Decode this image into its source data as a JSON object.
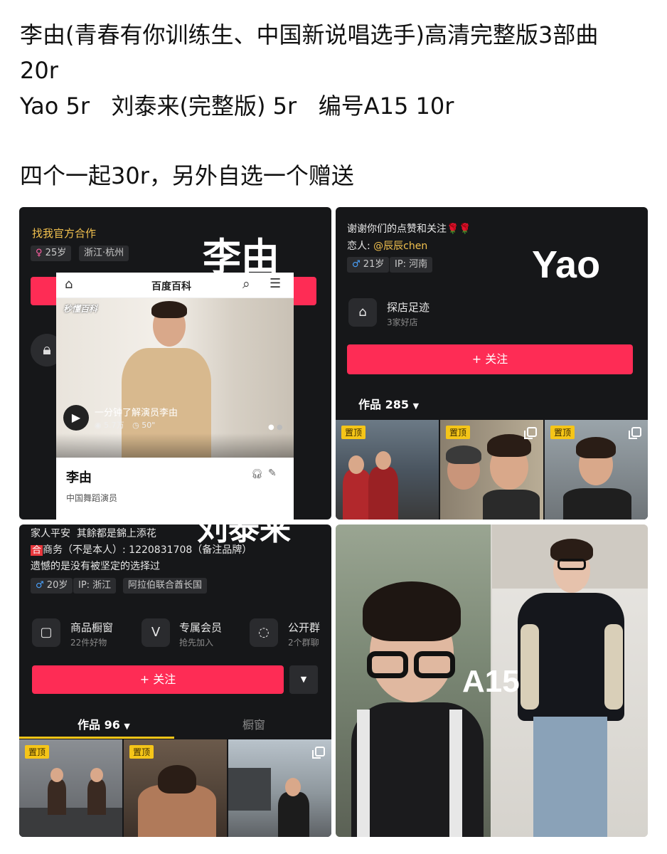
{
  "post": {
    "line1": "李由(青春有你训练生、中国新说唱选手)高清完整版3部曲",
    "line2": "20r",
    "line3": "Yao 5r   刘泰来(完整版) 5r   编号A15 10r",
    "line4": "四个一起30r，另外自选一个赠送"
  },
  "panel1": {
    "cooperate": "找我官方合作",
    "age_tag": "25岁",
    "location_tag": "浙江·杭州",
    "overlay_name": "李由",
    "baike_title": "百度百科",
    "baike_watermark": "秒懂百科",
    "video_title": "一分钟了解演员李由",
    "video_views": "5.7万",
    "video_duration": "50\"",
    "person_name": "李由",
    "person_desc": "中国舞蹈演员"
  },
  "panel2": {
    "bio_line1": "谢谢你们的点赞和关注🌹🌹",
    "bio_lover_prefix": "恋人: ",
    "bio_lover_name": "@辰辰chen",
    "age_tag": "21岁",
    "ip_tag": "IP: 河南",
    "overlay_name": "Yao",
    "shop_title": "探店足迹",
    "shop_sub": "3家好店",
    "follow_label": "+ 关注",
    "works_label": "作品 285",
    "pinned_label": "置顶"
  },
  "panel3": {
    "overlay_name": "刘泰来",
    "bio_line1": "家人平安  其餘都是錦上添花",
    "bio_line2_badge": "合",
    "bio_line2": "商务（不是本人）: 1220831708（备注品牌）",
    "bio_line3": "遗憾的是没有被坚定的选择过",
    "age_tag": "20岁",
    "ip_tag": "IP: 浙江",
    "region_tag": "阿拉伯联合酋长国",
    "svc1_title": "商品橱窗",
    "svc1_sub": "22件好物",
    "svc2_title": "专属会员",
    "svc2_sub": "抢先加入",
    "svc3_title": "公开群",
    "svc3_sub": "2个群聊",
    "follow_label": "+ 关注",
    "tab_works": "作品 96",
    "tab_shop": "橱窗",
    "pinned_label": "置顶"
  },
  "panel4": {
    "overlay_name": "A15"
  },
  "colors": {
    "accent_red": "#fe2c55",
    "pinned_yellow": "#f5c518",
    "panel_dark": "#161719",
    "link_yellow": "#f2c14e"
  }
}
